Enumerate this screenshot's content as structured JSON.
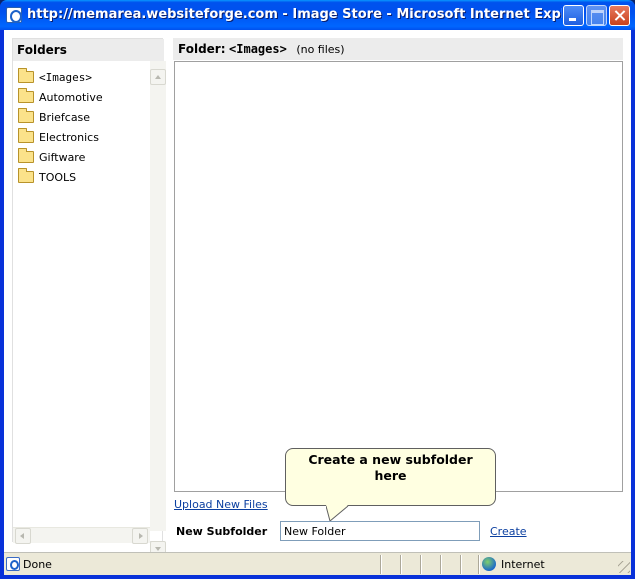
{
  "window": {
    "title": "http://memarea.websiteforge.com - Image Store - Microsoft Internet Explorer provid..."
  },
  "folders": {
    "header": "Folders",
    "items": [
      {
        "label": "<Images>",
        "selected": true
      },
      {
        "label": "Automotive",
        "selected": false
      },
      {
        "label": "Briefcase",
        "selected": false
      },
      {
        "label": "Electronics",
        "selected": false
      },
      {
        "label": "Giftware",
        "selected": false
      },
      {
        "label": "TOOLS",
        "selected": false
      }
    ]
  },
  "main": {
    "header_label": "Folder:",
    "current_folder": "<Images>",
    "file_count": "(no files)",
    "upload_link": "Upload New Files",
    "new_subfolder_label": "New Subfolder",
    "new_subfolder_value": "New Folder",
    "create_link": "Create"
  },
  "callout": {
    "line1": "Create a new subfolder",
    "line2": "here"
  },
  "statusbar": {
    "status": "Done",
    "zone": "Internet"
  }
}
